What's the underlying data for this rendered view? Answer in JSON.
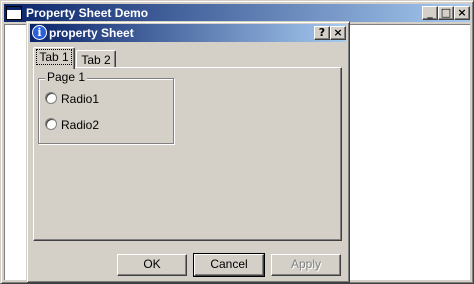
{
  "main_window": {
    "title": "Property Sheet Demo",
    "minimize_label": "_",
    "maximize_label": "□",
    "close_label": "×"
  },
  "dialog": {
    "title": "property Sheet",
    "info_glyph": "i",
    "help_label": "?",
    "close_label": "×",
    "tabs": [
      {
        "label": "Tab 1",
        "active": true
      },
      {
        "label": "Tab 2",
        "active": false
      }
    ],
    "group": {
      "label": "Page 1",
      "radios": [
        {
          "label": "Radio1",
          "checked": false
        },
        {
          "label": "Radio2",
          "checked": false
        }
      ]
    },
    "buttons": {
      "ok": "OK",
      "cancel": "Cancel",
      "apply": "Apply"
    }
  },
  "colors": {
    "face": "#d4d0c8",
    "title_start": "#0a246a",
    "title_end": "#a6caf0",
    "disabled_text": "#808080"
  },
  "icons": {
    "app": "window-icon",
    "info": "info-icon"
  }
}
